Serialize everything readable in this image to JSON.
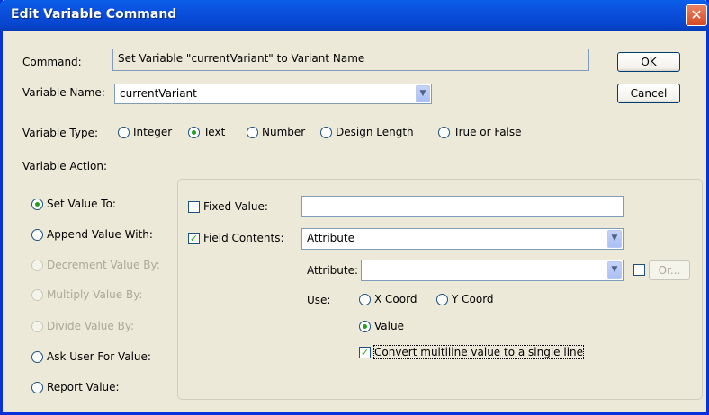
{
  "window": {
    "title": "Edit Variable Command",
    "close_glyph": "✕"
  },
  "command": {
    "label": "Command:",
    "value": "Set Variable \"currentVariant\" to Variant Name"
  },
  "variable_name": {
    "label": "Variable Name:",
    "value": "currentVariant"
  },
  "buttons": {
    "ok": "OK",
    "cancel": "Cancel",
    "or": "Or..."
  },
  "variable_type": {
    "label": "Variable Type:",
    "options": [
      "Integer",
      "Text",
      "Number",
      "Design Length",
      "True or False"
    ],
    "selected": "Text"
  },
  "variable_action": {
    "label": "Variable Action:",
    "options": [
      "Set Value To:",
      "Append Value With:",
      "Decrement Value By:",
      "Multiply Value By:",
      "Divide Value By:",
      "Ask User For Value:",
      "Report Value:"
    ],
    "selected": "Set Value To:",
    "disabled": [
      "Decrement Value By:",
      "Multiply Value By:",
      "Divide Value By:"
    ]
  },
  "fixed_value": {
    "label": "Fixed Value:",
    "checked": false,
    "value": ""
  },
  "field_contents": {
    "label": "Field Contents:",
    "checked": true,
    "value": "Attribute"
  },
  "attribute": {
    "label": "Attribute:",
    "value": ""
  },
  "use": {
    "label": "Use:",
    "options": [
      "X Coord",
      "Y Coord",
      "Value"
    ],
    "selected": "Value"
  },
  "convert": {
    "label": "Convert multiline value to a single line",
    "checked": true
  },
  "icons": {
    "dropdown": "chevron-down-icon",
    "close": "close-icon",
    "check": "checkmark-icon"
  },
  "colors": {
    "title_bar": "#0a4fdd",
    "dialog_bg": "#ece9d8",
    "radio_dot": "#21a121",
    "field_border": "#7f9db9"
  }
}
